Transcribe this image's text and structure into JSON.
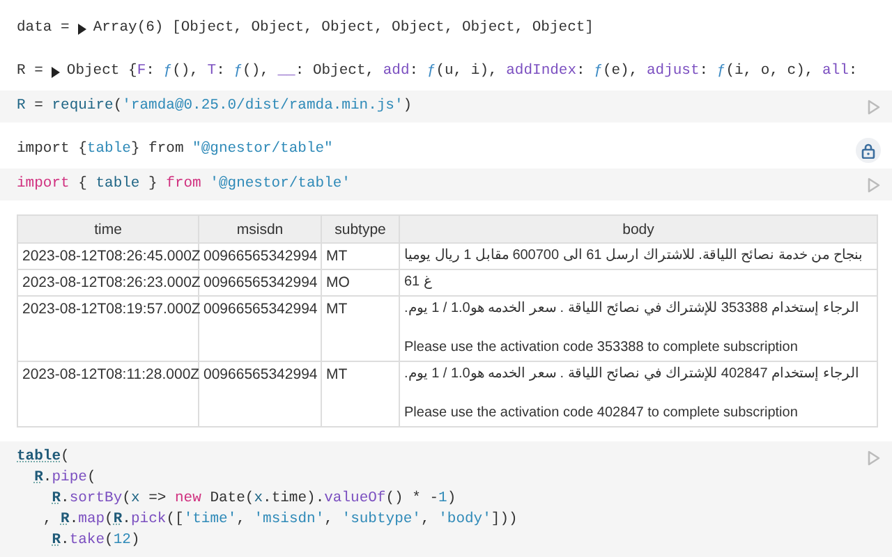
{
  "cells": [
    {
      "kind": "output",
      "label": "data =",
      "expanded": false,
      "tokens": [
        {
          "t": "Array(6) [Object, Object, Object, Object, Object, Object]",
          "kind": "plain"
        }
      ]
    },
    {
      "kind": "output",
      "label": "R =",
      "expanded": false,
      "tokens": [
        {
          "t": "Object {",
          "kind": "plain"
        },
        {
          "t": "F",
          "kind": "key"
        },
        {
          "t": ": ",
          "kind": "plain"
        },
        {
          "t": "ƒ",
          "kind": "fn"
        },
        {
          "t": "(), ",
          "kind": "plain"
        },
        {
          "t": "T",
          "kind": "key"
        },
        {
          "t": ": ",
          "kind": "plain"
        },
        {
          "t": "ƒ",
          "kind": "fn"
        },
        {
          "t": "(), ",
          "kind": "plain"
        },
        {
          "t": "__",
          "kind": "key"
        },
        {
          "t": ": Object, ",
          "kind": "plain"
        },
        {
          "t": "add",
          "kind": "key"
        },
        {
          "t": ": ",
          "kind": "plain"
        },
        {
          "t": "ƒ",
          "kind": "fn"
        },
        {
          "t": "(u, i), ",
          "kind": "plain"
        },
        {
          "t": "addIndex",
          "kind": "key"
        },
        {
          "t": ": ",
          "kind": "plain"
        },
        {
          "t": "ƒ",
          "kind": "fn"
        },
        {
          "t": "(e), ",
          "kind": "plain"
        },
        {
          "t": "adjust",
          "kind": "key"
        },
        {
          "t": ": ",
          "kind": "plain"
        },
        {
          "t": "ƒ",
          "kind": "fn"
        },
        {
          "t": "(i, o, c), ",
          "kind": "plain"
        },
        {
          "t": "all",
          "kind": "key"
        },
        {
          "t": ":",
          "kind": "plain"
        }
      ]
    },
    {
      "kind": "source",
      "lines": [
        {
          "kind": "top",
          "tokens": [
            {
              "t": "R",
              "kind": "var"
            },
            {
              "t": " = ",
              "kind": "plain"
            },
            {
              "t": "require",
              "kind": "var"
            },
            {
              "t": "(",
              "kind": "plain"
            },
            {
              "t": "'ramda@0.25.0/dist/ramda.min.js'",
              "kind": "string"
            },
            {
              "t": ")",
              "kind": "plain"
            }
          ]
        }
      ]
    },
    {
      "kind": "import",
      "locked": true,
      "tokens": [
        {
          "t": "import {",
          "kind": "plain"
        },
        {
          "t": "table",
          "kind": "string"
        },
        {
          "t": "} from ",
          "kind": "plain"
        },
        {
          "t": "\"@gnestor/table\"",
          "kind": "string"
        }
      ]
    },
    {
      "kind": "source",
      "lines": [
        {
          "kind": "top",
          "tokens": [
            {
              "t": "import",
              "kind": "keyword"
            },
            {
              "t": " { ",
              "kind": "plain"
            },
            {
              "t": "table",
              "kind": "var"
            },
            {
              "t": " } ",
              "kind": "plain"
            },
            {
              "t": "from",
              "kind": "keyword"
            },
            {
              "t": " '@gnestor/table'",
              "kind": "string"
            }
          ]
        }
      ]
    },
    {
      "kind": "table",
      "columns": [
        "time",
        "msisdn",
        "subtype",
        "body"
      ],
      "rows": [
        {
          "time": "2023-08-12T08:26:45.000Z",
          "msisdn": "00966565342994",
          "subtype": "MT",
          "body": [
            "بنجاح من خدمة نصائح اللياقة. للاشتراك ارسل 61 الى 600700 مقابل 1 ريال يوميا"
          ]
        },
        {
          "time": "2023-08-12T08:26:23.000Z",
          "msisdn": "00966565342994",
          "subtype": "MO",
          "body": [
            "غ 61"
          ]
        },
        {
          "time": "2023-08-12T08:19:57.000Z",
          "msisdn": "00966565342994",
          "subtype": "MT",
          "body": [
            ".الرجاء إستخدام 353388 للإشتراك في نصائح اللياقة . سعر الخدمه هو1.0 / 1 يوم",
            "Please use the activation code 353388 to complete subscription"
          ]
        },
        {
          "time": "2023-08-12T08:11:28.000Z",
          "msisdn": "00966565342994",
          "subtype": "MT",
          "body": [
            ".الرجاء إستخدام 402847 للإشتراك في نصائح اللياقة . سعر الخدمه هو1.0 / 1 يوم",
            "Please use the activation code 402847 to complete subscription"
          ]
        }
      ]
    },
    {
      "kind": "source",
      "lines": [
        {
          "kind": "top",
          "tokens": [
            {
              "t": "table",
              "kind": "ref"
            },
            {
              "t": "(",
              "kind": "plain"
            }
          ]
        },
        {
          "kind": "inner",
          "tokens": [
            {
              "t": "R",
              "kind": "ref"
            },
            {
              "t": ".",
              "kind": "plain"
            },
            {
              "t": "pipe",
              "kind": "method"
            },
            {
              "t": "(",
              "kind": "plain"
            }
          ]
        },
        {
          "kind": "deep",
          "tokens": [
            {
              "t": "R",
              "kind": "ref"
            },
            {
              "t": ".",
              "kind": "plain"
            },
            {
              "t": "sortBy",
              "kind": "method"
            },
            {
              "t": "(",
              "kind": "plain"
            },
            {
              "t": "x",
              "kind": "var"
            },
            {
              "t": " => ",
              "kind": "plain"
            },
            {
              "t": "new",
              "kind": "keyword"
            },
            {
              "t": " Date(",
              "kind": "plain"
            },
            {
              "t": "x",
              "kind": "var"
            },
            {
              "t": ".time).",
              "kind": "plain"
            },
            {
              "t": "valueOf",
              "kind": "method"
            },
            {
              "t": "() * -",
              "kind": "plain"
            },
            {
              "t": "1",
              "kind": "number"
            },
            {
              "t": ")",
              "kind": "plain"
            }
          ]
        },
        {
          "kind": "lead",
          "tokens": [
            {
              "t": ", ",
              "kind": "plain"
            },
            {
              "t": "R",
              "kind": "ref"
            },
            {
              "t": ".",
              "kind": "plain"
            },
            {
              "t": "map",
              "kind": "method"
            },
            {
              "t": "(",
              "kind": "plain"
            },
            {
              "t": "R",
              "kind": "ref"
            },
            {
              "t": ".",
              "kind": "plain"
            },
            {
              "t": "pick",
              "kind": "method"
            },
            {
              "t": "([",
              "kind": "plain"
            },
            {
              "t": "'time'",
              "kind": "string"
            },
            {
              "t": ", ",
              "kind": "plain"
            },
            {
              "t": "'msisdn'",
              "kind": "string"
            },
            {
              "t": ", ",
              "kind": "plain"
            },
            {
              "t": "'subtype'",
              "kind": "string"
            },
            {
              "t": ", ",
              "kind": "plain"
            },
            {
              "t": "'body'",
              "kind": "string"
            },
            {
              "t": "]))",
              "kind": "plain"
            }
          ]
        },
        {
          "kind": "deep",
          "tokens": [
            {
              "t": "R",
              "kind": "ref"
            },
            {
              "t": ".",
              "kind": "plain"
            },
            {
              "t": "take",
              "kind": "method"
            },
            {
              "t": "(",
              "kind": "plain"
            },
            {
              "t": "12",
              "kind": "number"
            },
            {
              "t": ")",
              "kind": "plain"
            }
          ]
        }
      ]
    }
  ]
}
